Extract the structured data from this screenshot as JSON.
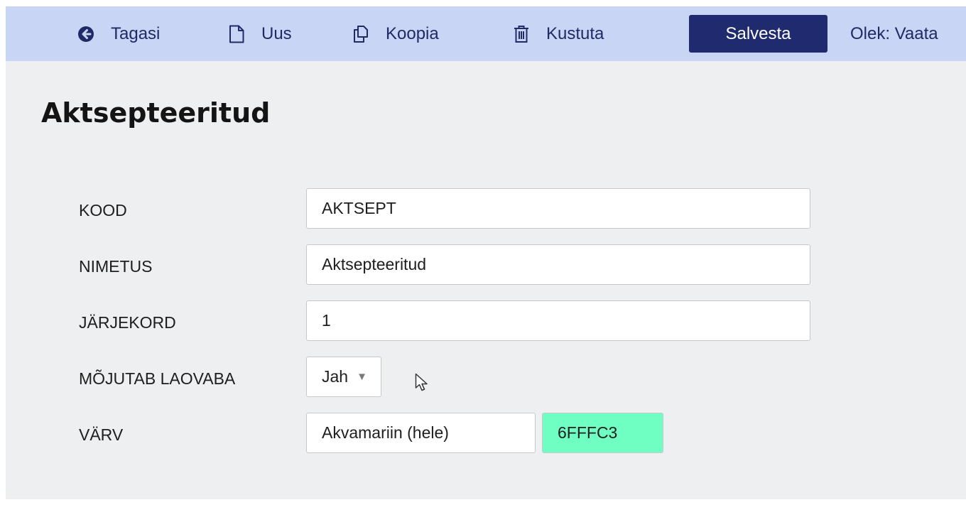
{
  "toolbar": {
    "back_label": "Tagasi",
    "new_label": "Uus",
    "copy_label": "Koopia",
    "delete_label": "Kustuta",
    "save_label": "Salvesta",
    "status_text": "Olek: Vaata"
  },
  "page": {
    "title": "Aktsepteeritud"
  },
  "form": {
    "kood": {
      "label": "KOOD",
      "value": "AKTSEPT"
    },
    "nimetus": {
      "label": "NIMETUS",
      "value": "Aktsepteeritud"
    },
    "jarjekord": {
      "label": "JÄRJEKORD",
      "value": "1"
    },
    "mojutab_laovaba": {
      "label": "MÕJUTAB LAOVABA",
      "selected": "Jah"
    },
    "varv": {
      "label": "VÄRV",
      "name": "Akvamariin (hele)",
      "hex": "6FFFC3"
    }
  },
  "colors": {
    "toolbar_bg": "#c9d5f4",
    "save_button_bg": "#1f2b6e",
    "swatch": "#6FFFC3",
    "page_bg": "#eeeff1"
  },
  "icons": {
    "back": "arrow-circle-left-icon",
    "new": "document-icon",
    "copy": "copy-icon",
    "delete": "trash-icon",
    "dropdown": "caret-down-icon",
    "cursor": "mouse-pointer-icon"
  }
}
